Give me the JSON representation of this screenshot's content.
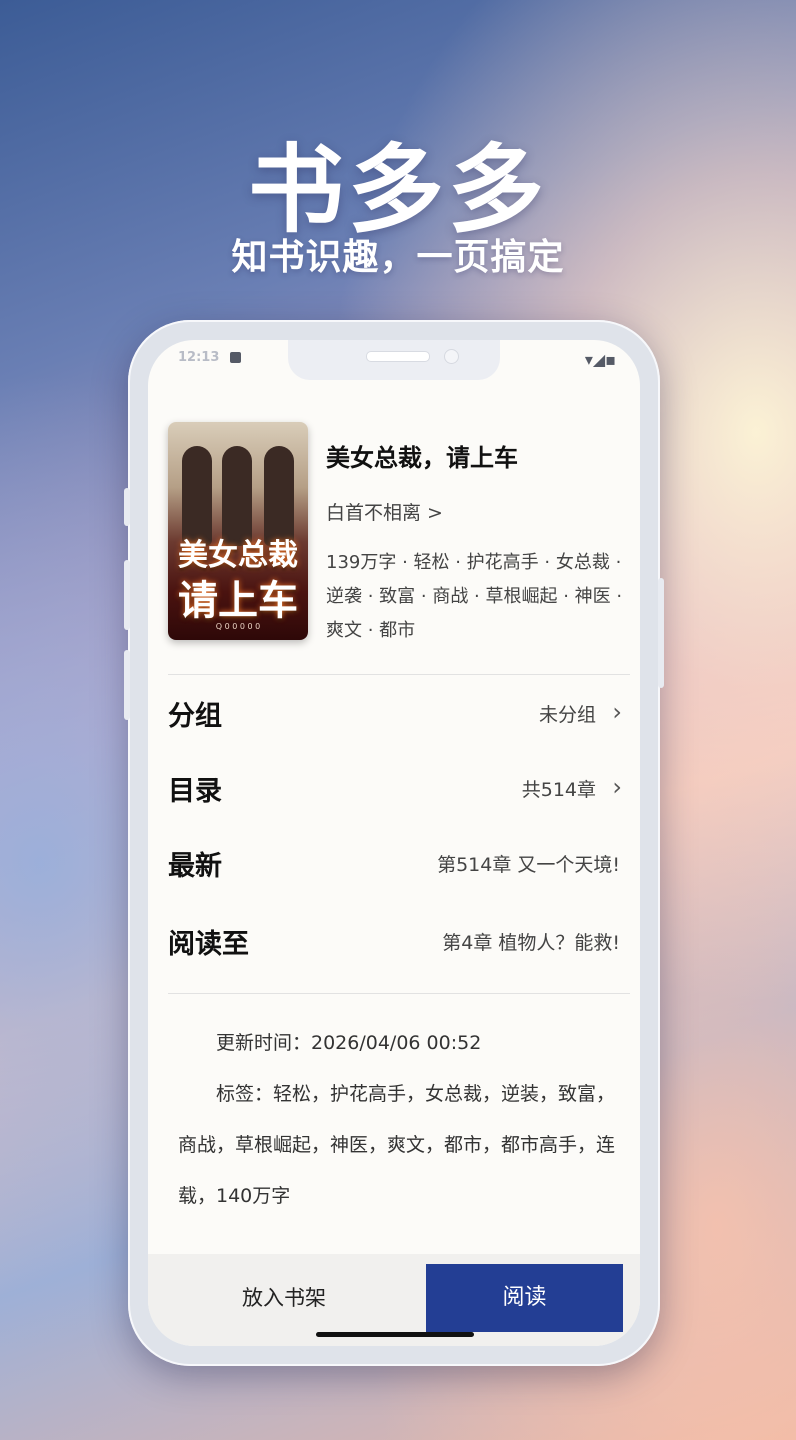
{
  "hero": {
    "title": "书多多",
    "subtitle": "知书识趣，一页搞定"
  },
  "status_bar": {
    "time": "12:13",
    "right_icons": "▾◢▪"
  },
  "book": {
    "cover_text_line1": "美女总裁",
    "cover_text_line2": "请上车",
    "cover_small_text": "Q 0 0 0 0 0",
    "title": "美女总裁，请上车",
    "author": "白首不相离 >",
    "meta": "139万字 · 轻松 · 护花高手 · 女总裁 · 逆袭 · 致富 · 商战 · 草根崛起 · 神医 · 爽文 · 都市"
  },
  "rows": [
    {
      "label": "分组",
      "value": "未分组",
      "chevron": "›"
    },
    {
      "label": "目录",
      "value": "共514章",
      "chevron": "›"
    },
    {
      "label": "最新",
      "value": "第514章  又一个天境!"
    },
    {
      "label": "阅读至",
      "value": "第4章  植物人？能救!"
    }
  ],
  "info": {
    "update_time": "　　更新时间：2026/04/06 00:52",
    "tags": "　　标签：轻松，护花高手，女总裁，逆装，致富，商战，草根崛起，神医，爽文，都市，都市高手，连载，140万字"
  },
  "actions": {
    "shelf": "放入书架",
    "read": "阅读"
  },
  "colors": {
    "primary_button": "#233e94"
  }
}
